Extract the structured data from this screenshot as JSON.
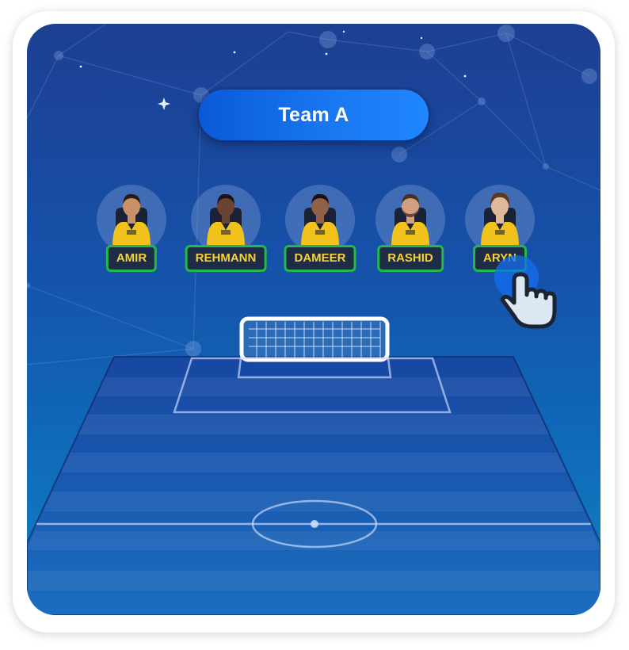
{
  "team": {
    "title": "Team A"
  },
  "players": [
    {
      "name": "AMIR",
      "skin": "#c9916a",
      "hair": "#2a1c14"
    },
    {
      "name": "REHMANN",
      "skin": "#6a4432",
      "hair": "#1c1410"
    },
    {
      "name": "DAMEER",
      "skin": "#8f6248",
      "hair": "#1a1210"
    },
    {
      "name": "RASHID",
      "skin": "#d2a07f",
      "hair": "#4a3222"
    },
    {
      "name": "ARYN",
      "skin": "#e2b89a",
      "hair": "#5a3a22"
    }
  ],
  "colors": {
    "jersey": "#f2c21c",
    "name_text": "#f5d23a",
    "name_border": "#24b84a",
    "name_bg": "#1f2c46",
    "pill": "#1979f2"
  },
  "icons": {
    "cursor": "hand-pointer-icon",
    "goal": "goal-net-icon"
  }
}
